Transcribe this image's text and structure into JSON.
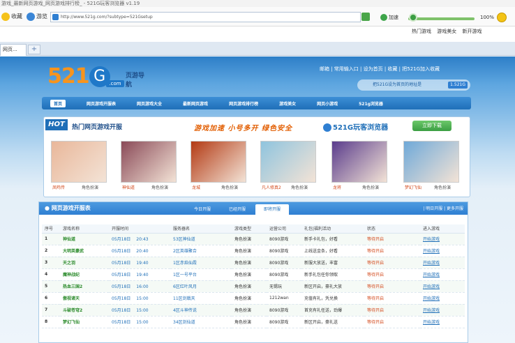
{
  "window": {
    "title": "游戏_最新网页游戏_网页游戏排行榜_ - 521G玩客浏览器 v1.19"
  },
  "toolbar": {
    "favorites": "收藏",
    "back": "游览",
    "address": "http://www.521g.com/?subtype=521Gsetup",
    "speed": "加速",
    "zoom": "100%"
  },
  "favbar": {
    "items": [
      "热门游戏",
      "游戏美女",
      "新开游戏"
    ]
  },
  "tabs": [
    {
      "label": "网页..."
    }
  ],
  "site": {
    "logo": {
      "num": "521",
      "g": "G",
      "com": ".com",
      "sub": "页游导航"
    },
    "toplinks": "邮箱  | 常用输入口  |  设为首页  | 收藏  | 把521G加入收藏",
    "corner": {
      "text": "把521G设为首页的地址是",
      "badge": "1.521G"
    },
    "nav": [
      "首页",
      "网页游戏开服表",
      "网页游戏大全",
      "最新网页游戏",
      "网页游戏排行榜",
      "游戏美女",
      "网页小游戏",
      "521g浏览器"
    ]
  },
  "hot": {
    "label": "HOT",
    "title": "热门网页游戏开服",
    "slogan": "游戏加速  小号多开  绿色安全",
    "browser": "521G玩客浏览器",
    "download": "立即下载",
    "games": [
      {
        "name": "凤鸣传",
        "type": "角色扮演",
        "thumb": "#e9b79a"
      },
      {
        "name": "神仙道",
        "type": "角色扮演",
        "thumb": "#8a4a58"
      },
      {
        "name": "龙城",
        "type": "角色扮演",
        "thumb": "#b33a14"
      },
      {
        "name": "凡人修真2",
        "type": "角色扮演",
        "thumb": "#8fc4de"
      },
      {
        "name": "龙将",
        "type": "角色扮演",
        "thumb": "#5a3c8c"
      },
      {
        "name": "梦幻飞仙",
        "type": "角色扮演",
        "thumb": "#6fa9d8"
      }
    ]
  },
  "servers": {
    "title": "网页游戏开服表",
    "tabs": [
      "今日开服",
      "已经开服",
      "即将开服"
    ],
    "links": "| 明日开服  | 更多开服",
    "columns": [
      "序号",
      "游戏名称",
      "开服时间",
      "服务器名",
      "游戏类型",
      "运营公司",
      "礼包|福利活动",
      "状态",
      "进入游戏"
    ],
    "rows": [
      [
        "1",
        "神仙道",
        "05月18日",
        "20:43",
        "53区神仙道",
        "角色扮演",
        "8090游戏",
        "新手卡礼包，好看",
        "等待开启",
        "开始游戏"
      ],
      [
        "2",
        "大明英豪武",
        "05月18日",
        "20:40",
        "2区英雄聚合",
        "角色扮演",
        "8090游戏",
        "上线送金条，好看",
        "等待开启",
        "开始游戏"
      ],
      [
        "3",
        "天之羽",
        "05月18日",
        "19:40",
        "1区赤焰仙霞",
        "角色扮演",
        "8090游戏",
        "新服大放送，丰富",
        "等待开启",
        "开始游戏"
      ],
      [
        "4",
        "魔神战纪",
        "05月18日",
        "19:40",
        "1区一号平台",
        "角色扮演",
        "8090游戏",
        "新手礼包任你领取",
        "等待开启",
        "开始游戏"
      ],
      [
        "5",
        "热血三国2",
        "05月18日",
        "16:00",
        "6区红叶风月",
        "角色扮演",
        "无锡玩",
        "新区开启，豪礼大放",
        "等待开启",
        "开始游戏"
      ],
      [
        "6",
        "傲视诸天",
        "05月18日",
        "15:00",
        "11区剑戟天",
        "角色扮演",
        "1212wan",
        "充值有礼，凭兑换",
        "等待开启",
        "开始游戏"
      ],
      [
        "7",
        "斗破苍穹2",
        "05月18日",
        "15:00",
        "4区斗神传说",
        "角色扮演",
        "8090游戏",
        "首充有礼任送，劲爆",
        "等待开启",
        "开始游戏"
      ],
      [
        "8",
        "梦幻飞仙",
        "05月18日",
        "15:00",
        "34区剑仙道",
        "角色扮演",
        "8090游戏",
        "新区开启，豪礼送",
        "等待开启",
        "开始游戏"
      ]
    ]
  }
}
